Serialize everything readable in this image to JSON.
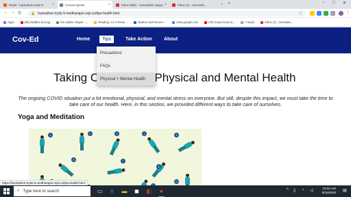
{
  "browser": {
    "tabs": [
      {
        "title": "Replit - hackathon-tryits-5",
        "favicon_color": "#f26207",
        "active": false
      },
      {
        "title": "Corona Quest!",
        "favicon_color": "#7d7d7d",
        "active": true
      },
      {
        "title": "Inbox (959) - meenakshi.rajaya...",
        "favicon_color": "#d93025",
        "active": false
      },
      {
        "title": "Inbox (1) - meenaks...",
        "favicon_color": "#d93025",
        "active": false
      }
    ],
    "url": "hackathon-tryits-5.medharajan.repl.co/tips-health.html",
    "bookmarks": [
      {
        "label": "Apps",
        "color": "#4285f4"
      },
      {
        "label": "(65) Medline tlj song",
        "color": "#ff0000"
      },
      {
        "label": "the sabine chapel - ...",
        "color": "#34a853"
      },
      {
        "label": "Reading, CA 3 Revie...",
        "color": "#fbbc05"
      },
      {
        "label": "Student and Recent ...",
        "color": "#0a66c2"
      },
      {
        "label": "www.google.com",
        "color": "#4285f4"
      },
      {
        "label": "(78) recipe book pr...",
        "color": "#ff0000"
      },
      {
        "label": "7 mpd1",
        "color": "#9aa0a6"
      },
      {
        "label": "Inbox (1) - meenaks...",
        "color": "#d93025"
      }
    ],
    "status_url": "https://hackathon-tryits-5.medharajan.repl.co/tips-health.html"
  },
  "site": {
    "brand": "Cov-Ed",
    "nav": {
      "home": "Home",
      "tips": "Tips",
      "take_action": "Take Action",
      "about": "About"
    },
    "dropdown": [
      "Precautions",
      "FAQs",
      "Physical + Mental Health"
    ],
    "page_title": "Taking Care of Our Physical and Mental Health",
    "intro": "The ongoing COVID situation put a lot emotional, physical, and mental stress on everyone. But still, despite this impact, we must take the time to take care of our health. Here, in this section, we provided different ways to take care of ourselves.",
    "section_title": "Yoga and Meditation",
    "pose_numbers": [
      "1",
      "2",
      "3",
      "4",
      "5",
      "6",
      "7",
      "8",
      "9",
      "10",
      "11",
      "12"
    ]
  },
  "taskbar": {
    "search_placeholder": "Type here to search",
    "time": "10:34 AM",
    "date": "9/16/2020"
  },
  "colors": {
    "nav_bg": "#0c1f82",
    "yoga_bg": "#f0f7dc"
  }
}
